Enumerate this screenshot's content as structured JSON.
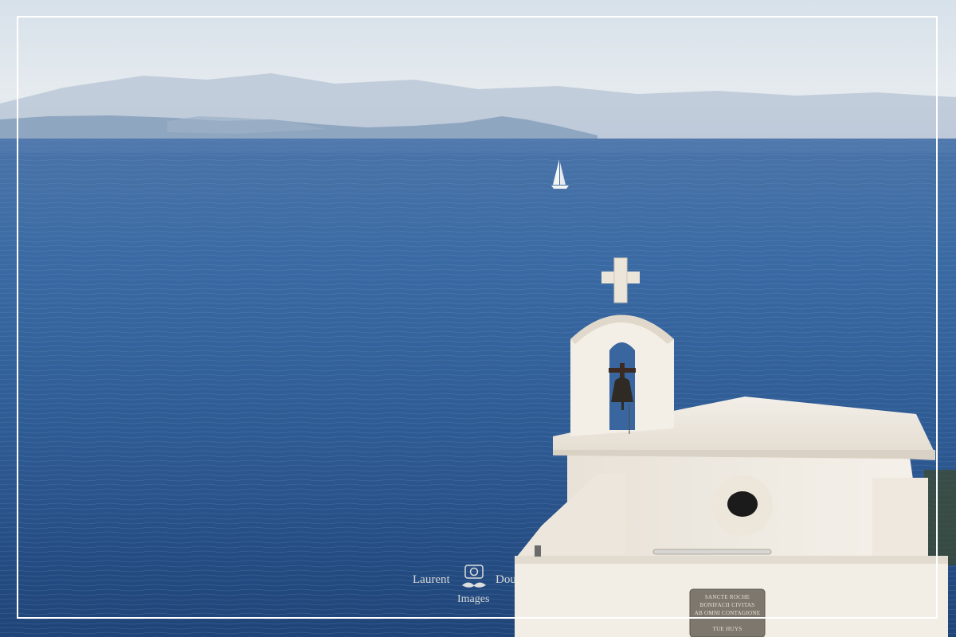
{
  "watermark": {
    "first_name": "Laurent",
    "last_name": "Doussot",
    "subtitle": "Images",
    "logo_icon": "camera-mustache-icon"
  },
  "plaque": {
    "line1": "SANCTE ROCHE",
    "line2": "BONIFACII CIVITAS",
    "line3": "AB OMNI CONTAGIONE",
    "line4": "TUE HUYS"
  },
  "colors": {
    "sea": "#2f5a94",
    "sky": "#dce6ee",
    "chapel": "#f1ece3",
    "frame": "#ffffff"
  }
}
